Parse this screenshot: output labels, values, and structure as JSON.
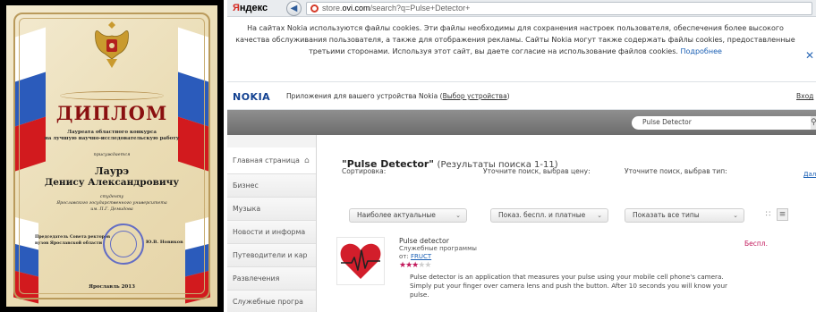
{
  "diploma": {
    "title": "ДИПЛОМ",
    "line1": "Лауреата областного конкурса",
    "line2": "на лучшую научно-исследовательскую работу",
    "line3": "присуждается",
    "surname": "Лаурэ",
    "name": "Денису Александровичу",
    "line6": "студенту",
    "line7": "Ярославского государственного университета",
    "line8": "им. П.Г. Демидова",
    "sign_left_1": "Председатель Совета ректоров",
    "sign_left_2": "вузов Ярославской области",
    "sign_right": "Ю.В. Новиков",
    "year": "Ярославль 2013",
    "colors": {
      "flag_white": "#ffffff",
      "flag_blue": "#2b5bbb",
      "flag_red": "#d21a1e",
      "title": "#8a1010"
    }
  },
  "browser": {
    "yandex_logo_a": "Я",
    "yandex_logo_b": "ндекс",
    "back_icon": "arrow-left-icon",
    "url_prefix": "store.",
    "url_domain": "ovi.com",
    "url_path": "/search?q=Pulse+Detector+",
    "cookie_notice": "На сайтах Nokia используются файлы cookies. Эти файлы необходимы для сохранения настроек пользователя, обеспечения более высокого качества обслуживания пользователя, а также для отображения рекламы. Сайты Nokia могут также содержать файлы cookies, предоставленные третьими сторонами. Используя этот сайт, вы даете согласие на использование файлов cookies.",
    "cookie_more": "Подробнее",
    "cookie_close": "✕",
    "nokia_logo": "NOKIA",
    "apps_text": "Приложения для вашего устройства Nokia",
    "device_link": "Выбор устройства",
    "login": "Вход",
    "search_value": "Pulse Detector",
    "sidebar": [
      "Главная страница",
      "Бизнес",
      "Музыка",
      "Новости и информа",
      "Путеводители и кар",
      "Развлечения",
      "Служебные програ"
    ],
    "results_title": "\"Pulse Detector\"",
    "results_count": "(Результаты поиска 1-11)",
    "more": "Дал",
    "sort_label": "Сортировка:",
    "sort_value": "Наиболее актуальные",
    "price_label": "Уточните поиск, выбрав цену:",
    "price_value": "Показ. беспл. и платные",
    "type_label": "Уточните поиск, выбрав тип:",
    "type_value": "Показать все типы",
    "app": {
      "name": "Pulse detector",
      "category": "Служебные программы",
      "from_label": "от:",
      "publisher": "FRUCT",
      "rating": 3,
      "rating_max": 5,
      "price": "Беспл.",
      "description": "Pulse detector is an application that measures your pulse using your mobile cell phone's camera. Simply put your finger over camera lens and push the button. After 10 seconds you will know your pulse."
    },
    "colors": {
      "accent_pink": "#c2185b",
      "link_blue": "#1a5fb4",
      "nokia_blue": "#124191",
      "yandex_red": "#d4271f"
    }
  }
}
